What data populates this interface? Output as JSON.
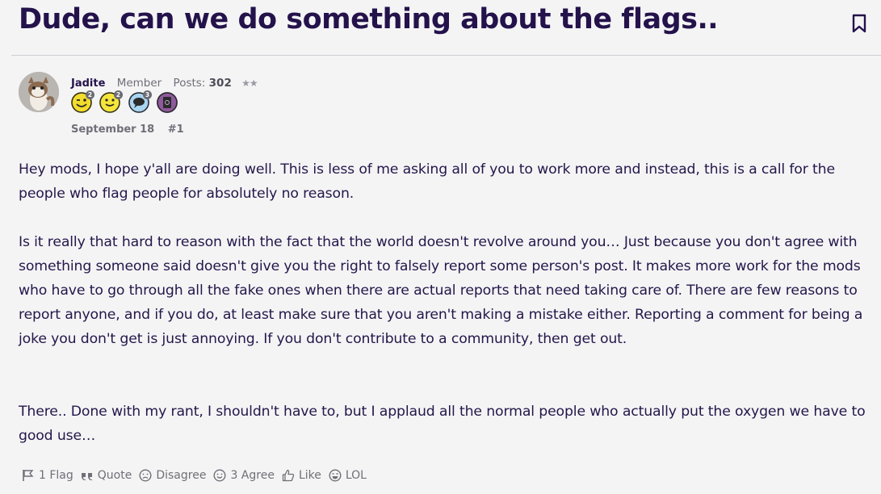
{
  "thread": {
    "title": "Dude, can we do something about the flags.."
  },
  "post": {
    "author": {
      "name": "Jadite",
      "role": "Member",
      "posts_label": "Posts:",
      "posts_count": "302",
      "stars": "★★"
    },
    "badges": [
      {
        "icon": "winking-face-badge-icon",
        "count": "2",
        "color": "#f2dc2c"
      },
      {
        "icon": "smiling-face-badge-icon",
        "count": "2",
        "color": "#f5e53a"
      },
      {
        "icon": "speech-bubble-badge-icon",
        "count": "3",
        "color": "#a9d4f2"
      },
      {
        "icon": "book-badge-icon",
        "count": "",
        "color": "#8e5a9c"
      }
    ],
    "date": "September 18",
    "number": "#1",
    "paragraphs": [
      "Hey mods, I hope y'all are doing well. This is less of me asking all of you to work more and instead, this is a call for the people who flag people for absolutely no reason.",
      "Is it really that hard to reason with the fact that the world doesn't revolve around you… Just because you don't agree with something someone said doesn't give you the right to falsely report some person's post. It makes more work for the mods who have to go through all the fake ones when there are actual reports that need taking care of. There are few reasons to report anyone, and if you do, at least make sure that you aren't making a mistake either. Reporting a comment for being a joke you don't get is just annoying. If you don't contribute to a community, then get out.",
      "There.. Done with my rant, I shouldn't have to, but I applaud all the normal people who actually put the oxygen we have to good use…"
    ],
    "reactions": {
      "flag": "1 Flag",
      "quote": "Quote",
      "disagree": "Disagree",
      "agree": "3 Agree",
      "like": "Like",
      "lol": "LOL"
    }
  },
  "colors": {
    "title": "#24124b",
    "text": "#25174a",
    "meta": "#6f6f78",
    "background": "#f4f4f5"
  }
}
